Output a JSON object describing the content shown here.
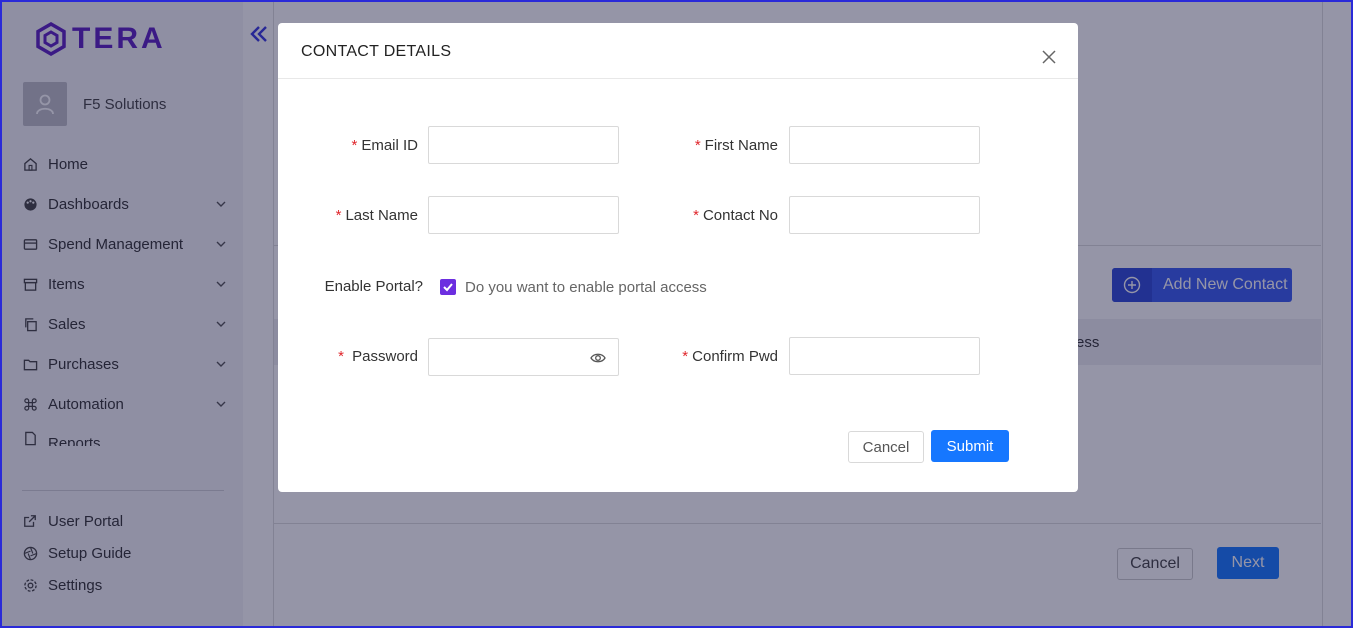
{
  "app": {
    "logo_text": "TERA",
    "org_name": "F5 Solutions"
  },
  "sidebar": {
    "items": [
      {
        "label": "Home",
        "icon": "home-icon"
      },
      {
        "label": "Dashboards",
        "icon": "palette-icon"
      },
      {
        "label": "Spend Management",
        "icon": "card-icon"
      },
      {
        "label": "Items",
        "icon": "box-icon"
      },
      {
        "label": "Sales",
        "icon": "copy-icon"
      },
      {
        "label": "Purchases",
        "icon": "folder-icon"
      },
      {
        "label": "Automation",
        "icon": "command-icon"
      },
      {
        "label": "Reports",
        "icon": "file-icon"
      }
    ],
    "footer": [
      {
        "label": "User Portal",
        "icon": "external-link-icon"
      },
      {
        "label": "Setup Guide",
        "icon": "aperture-icon"
      },
      {
        "label": "Settings",
        "icon": "gear-icon"
      }
    ]
  },
  "background": {
    "add_contact_label": "Add New Contact",
    "table_header_partial": "ess",
    "cancel_label": "Cancel",
    "next_label": "Next"
  },
  "modal": {
    "title": "CONTACT DETAILS",
    "email_label": "Email ID",
    "first_name_label": "First Name",
    "last_name_label": "Last Name",
    "contact_no_label": "Contact No",
    "enable_portal_label": "Enable Portal?",
    "portal_checkbox_label": "Do you want to enable portal access",
    "portal_checked": true,
    "password_label": "Password",
    "confirm_pwd_label": "Confirm Pwd",
    "email_value": "",
    "first_name_value": "",
    "last_name_value": "",
    "contact_no_value": "",
    "password_value": "",
    "confirm_pwd_value": "",
    "cancel_label": "Cancel",
    "submit_label": "Submit"
  },
  "colors": {
    "brand": "#5c1fc2",
    "primary": "#1677ff",
    "required": "#e0262c",
    "checkbox": "#6c2ee0"
  }
}
